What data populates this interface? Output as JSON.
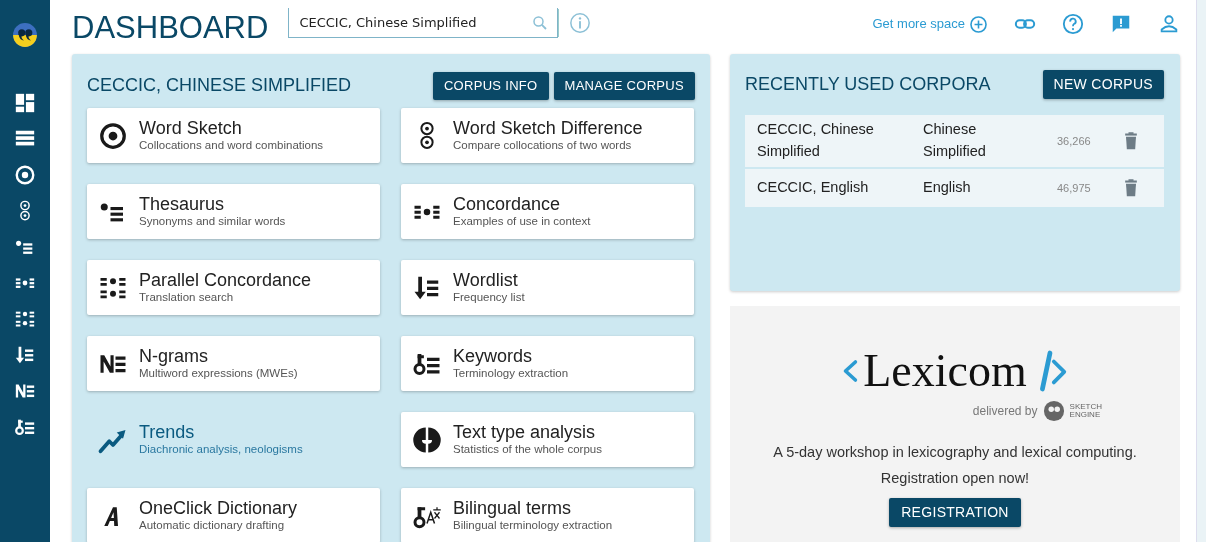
{
  "header": {
    "title": "DASHBOARD",
    "search": {
      "value": "CECCIC, Chinese Simplified"
    },
    "more_space_link": "Get more space"
  },
  "corpus_panel": {
    "title": "CECCIC, CHINESE SIMPLIFIED",
    "buttons": [
      "CORPUS INFO",
      "MANAGE CORPUS"
    ],
    "tools": [
      {
        "kind": "wordsketch",
        "title": "Word Sketch",
        "subtitle": "Collocations and word combinations",
        "highlighted": false
      },
      {
        "kind": "wsdiff",
        "title": "Word Sketch Difference",
        "subtitle": "Compare collocations of two words",
        "highlighted": false
      },
      {
        "kind": "thesaurus",
        "title": "Thesaurus",
        "subtitle": "Synonyms and similar words",
        "highlighted": false
      },
      {
        "kind": "concordance",
        "title": "Concordance",
        "subtitle": "Examples of use in context",
        "highlighted": false
      },
      {
        "kind": "parallel",
        "title": "Parallel Concordance",
        "subtitle": "Translation search",
        "highlighted": false
      },
      {
        "kind": "wordlist",
        "title": "Wordlist",
        "subtitle": "Frequency list",
        "highlighted": false
      },
      {
        "kind": "ngrams",
        "title": "N-grams",
        "subtitle": "Multiword expressions (MWEs)",
        "highlighted": false
      },
      {
        "kind": "keywords",
        "title": "Keywords",
        "subtitle": "Terminology extraction",
        "highlighted": false
      },
      {
        "kind": "trends",
        "title": "Trends",
        "subtitle": "Diachronic analysis, neologisms",
        "highlighted": true
      },
      {
        "kind": "texttype",
        "title": "Text type analysis",
        "subtitle": "Statistics of the whole corpus",
        "highlighted": false
      },
      {
        "kind": "oneclick",
        "title": "OneClick Dictionary",
        "subtitle": "Automatic dictionary drafting",
        "highlighted": false
      },
      {
        "kind": "bilingual",
        "title": "Bilingual terms",
        "subtitle": "Bilingual terminology extraction",
        "highlighted": false
      }
    ]
  },
  "recent_panel": {
    "title": "RECENTLY USED CORPORA",
    "button": "NEW CORPUS",
    "rows": [
      {
        "name": "CECCIC, Chinese Simplified",
        "language": "Chinese Simplified",
        "size": "36,266"
      },
      {
        "name": "CECCIC, English",
        "language": "English",
        "size": "46,975"
      }
    ]
  },
  "ad_panel": {
    "logo": "Lexicom",
    "delivered_by": "delivered by",
    "brand": [
      "SKETCH",
      "ENGINE"
    ],
    "text": "A 5-day workshop in lexicography and lexical computing.",
    "subtext": "Registration open now!",
    "button": "REGISTRATION"
  }
}
